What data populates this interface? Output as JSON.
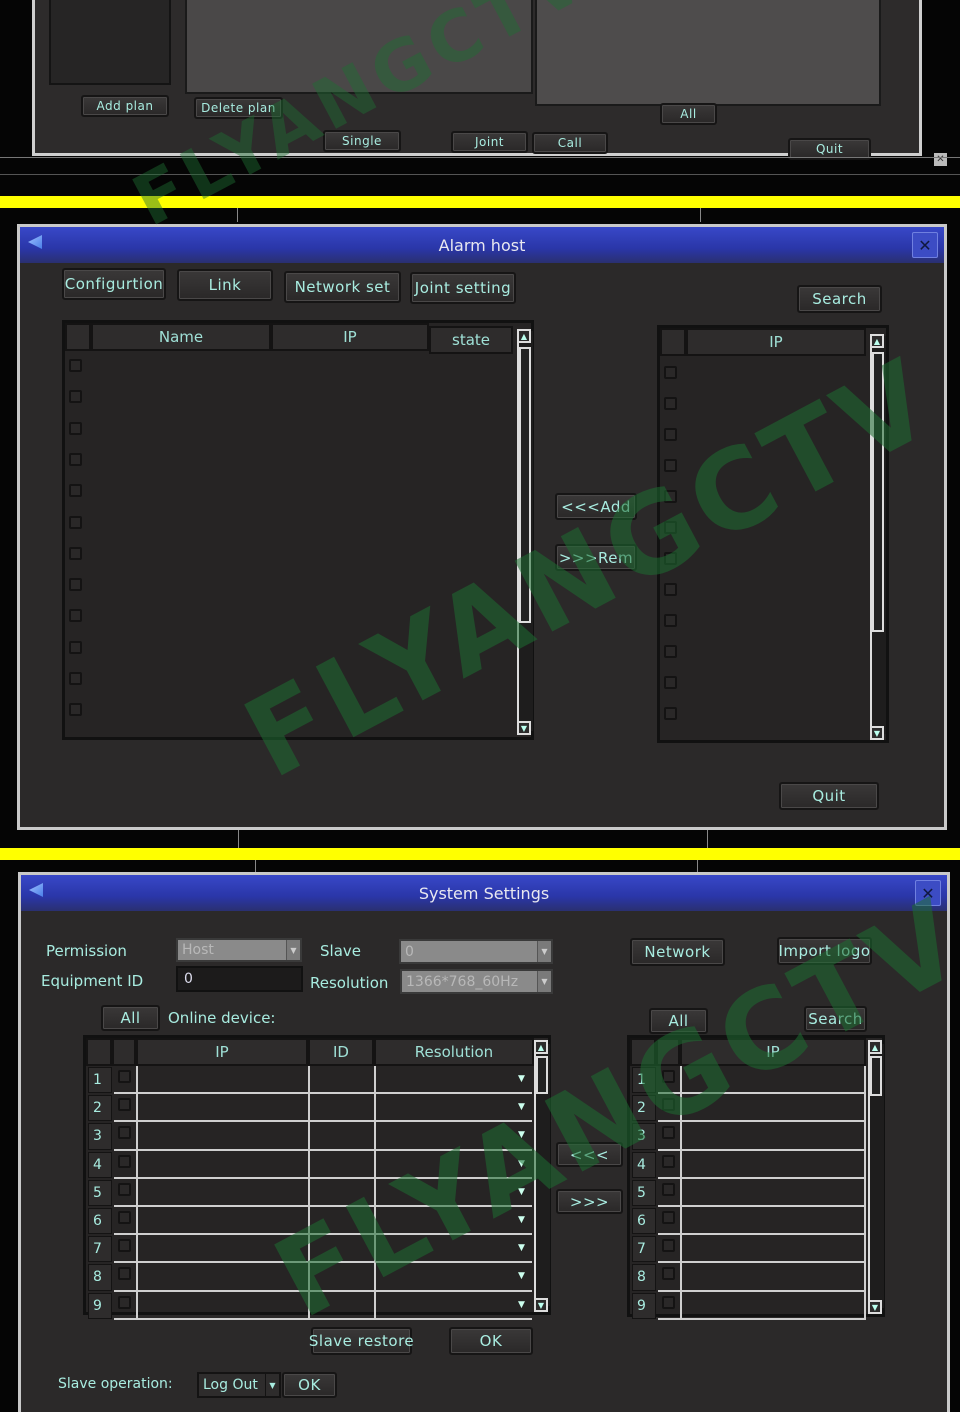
{
  "top_panel": {
    "buttons": {
      "add_plan": "Add plan",
      "delete_plan": "Delete plan",
      "single": "Single",
      "joint": "Joint",
      "call": "Call",
      "all": "All",
      "quit": "Quit"
    }
  },
  "alarm_host": {
    "title": "Alarm host",
    "close": "✕",
    "tabs": [
      {
        "label": "Configurtion"
      },
      {
        "label": "Link"
      },
      {
        "label": "Network set"
      },
      {
        "label": "Joint setting"
      }
    ],
    "search_label": "Search",
    "left_table": {
      "columns": [
        "Name",
        "IP",
        "state"
      ],
      "row_count": 12
    },
    "right_table": {
      "columns": [
        "IP"
      ],
      "row_count": 12
    },
    "add_label": "<<<Add",
    "rem_label": ">>>Rem",
    "quit_label": "Quit"
  },
  "system_settings": {
    "title": "System Settings",
    "close": "✕",
    "permission_label": "Permission",
    "permission_value": "Host",
    "slave_label": "Slave",
    "slave_value": "0",
    "equipment_id_label": "Equipment ID",
    "equipment_id_value": "0",
    "resolution_label": "Resolution",
    "resolution_value": "1366*768_60Hz",
    "network_label": "Network",
    "import_logo_label": "Import logo",
    "all_left_label": "All",
    "online_device_label": "Online device:",
    "all_right_label": "All",
    "search_label": "Search",
    "left_table": {
      "columns": [
        "IP",
        "ID",
        "Resolution"
      ],
      "rows": [
        "1",
        "2",
        "3",
        "4",
        "5",
        "6",
        "7",
        "8",
        "9"
      ]
    },
    "right_table": {
      "columns": [
        "IP"
      ],
      "rows": [
        "1",
        "2",
        "3",
        "4",
        "5",
        "6",
        "7",
        "8",
        "9"
      ]
    },
    "move_left_label": "<<<",
    "move_right_label": ">>>",
    "slave_restore_label": "Slave restore",
    "ok_label": "OK",
    "slave_operation_label": "Slave operation:",
    "slave_operation_value": "Log Out",
    "slave_operation_ok": "OK"
  },
  "watermark": "FLYANGCTV"
}
